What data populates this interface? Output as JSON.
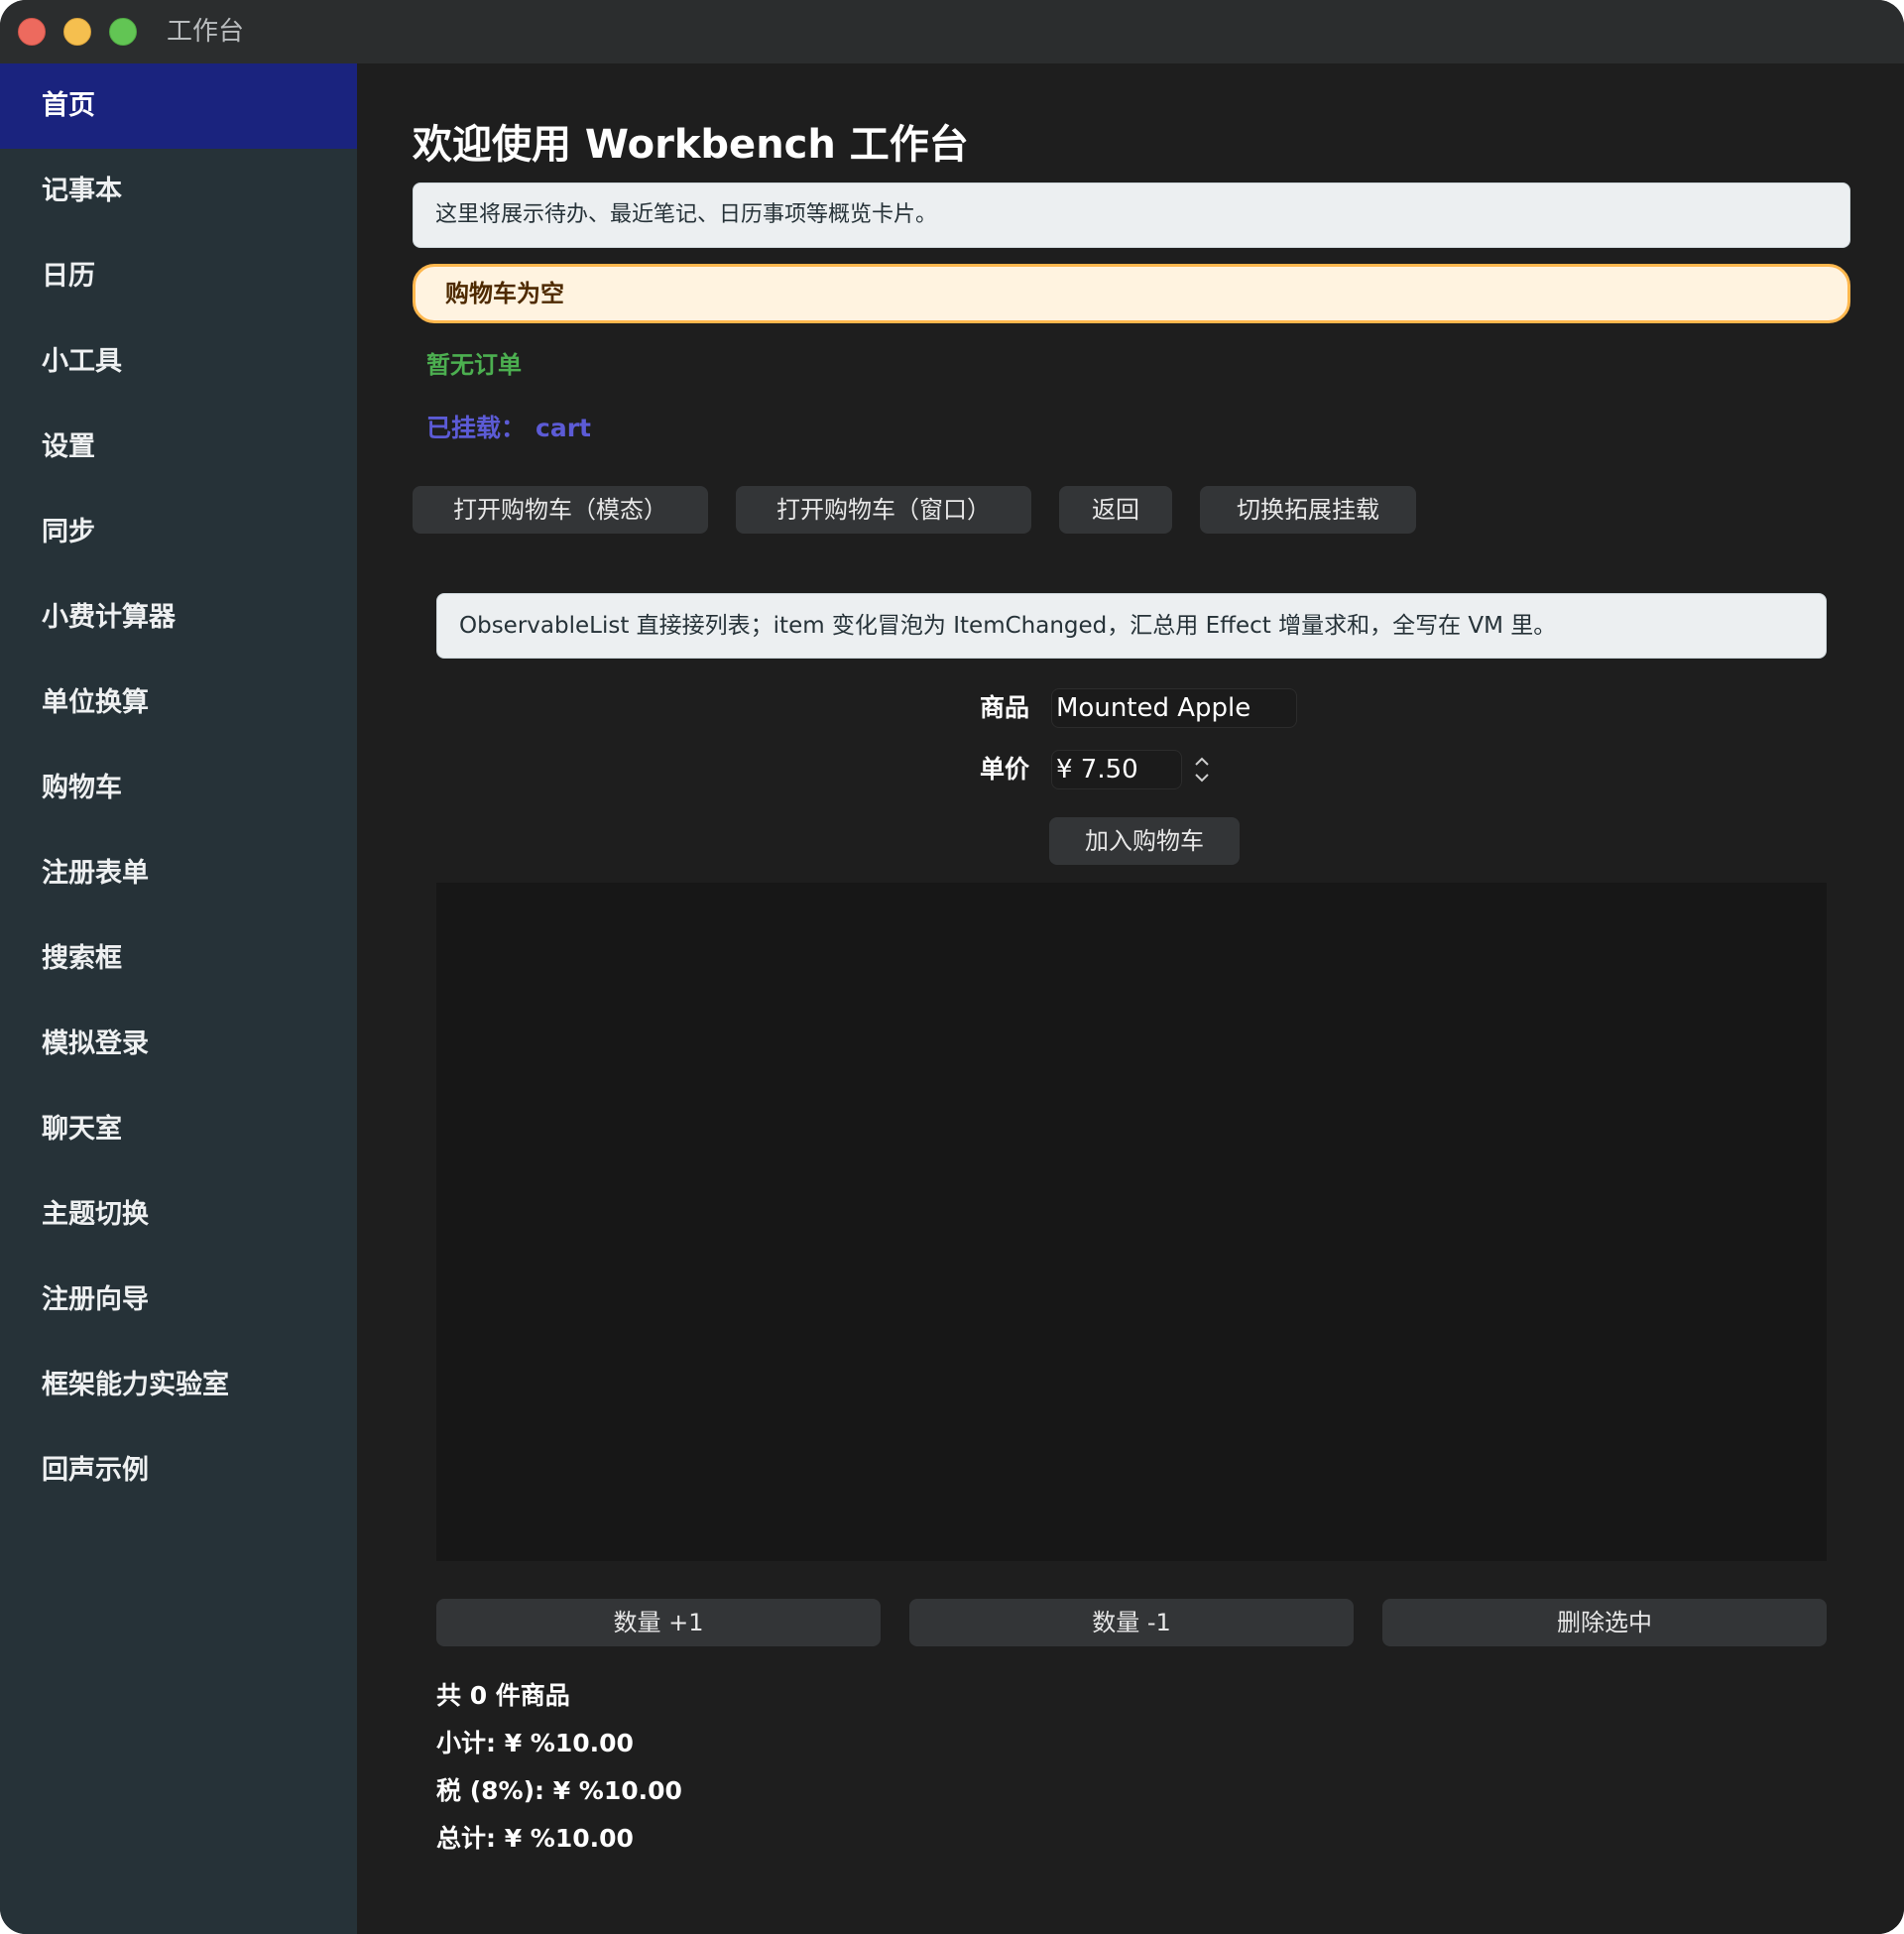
{
  "window": {
    "title": "工作台"
  },
  "sidebar": {
    "items": [
      {
        "label": "首页"
      },
      {
        "label": "记事本"
      },
      {
        "label": "日历"
      },
      {
        "label": "小工具"
      },
      {
        "label": "设置"
      },
      {
        "label": "同步"
      },
      {
        "label": "小费计算器"
      },
      {
        "label": "单位换算"
      },
      {
        "label": "购物车"
      },
      {
        "label": "注册表单"
      },
      {
        "label": "搜索框"
      },
      {
        "label": "模拟登录"
      },
      {
        "label": "聊天室"
      },
      {
        "label": "主题切换"
      },
      {
        "label": "注册向导"
      },
      {
        "label": "框架能力实验室"
      },
      {
        "label": "回声示例"
      }
    ],
    "active_index": 0,
    "active_color": "#1a237e"
  },
  "main": {
    "title": "欢迎使用 Workbench 工作台",
    "overview_text": "这里将展示待办、最近笔记、日历事项等概览卡片。",
    "cart_status": "购物车为空",
    "orders_status": "暂无订单",
    "mounted_label": "已挂载：",
    "mounted_value": "cart",
    "buttons": {
      "open_cart_modal": "打开购物车（模态）",
      "open_cart_window": "打开购物车（窗口）",
      "back": "返回",
      "toggle_extension": "切换拓展挂载"
    },
    "description": "ObservableList 直接接列表；item 变化冒泡为 ItemChanged，汇总用 Effect 增量求和，全写在 VM 里。",
    "form": {
      "product_label": "商品",
      "product_value": "Mounted Apple",
      "price_label": "单价",
      "price_value": "¥ 7.50",
      "add_button": "加入购物车"
    },
    "cart_items": [],
    "actions": {
      "qty_plus": "数量 +1",
      "qty_minus": "数量 -1",
      "delete_selected": "删除选中"
    },
    "summary": {
      "count": "共 0 件商品",
      "subtotal": "小计: ¥ %10.00",
      "tax": "税 (8%): ¥ %10.00",
      "total": "总计: ¥ %10.00"
    }
  },
  "colors": {
    "sidebar_bg": "#263238",
    "main_bg": "#1e1e1e",
    "warn_border": "#ffb74d",
    "success_text": "#4caf50",
    "mounted_text": "#5c5bd6"
  }
}
